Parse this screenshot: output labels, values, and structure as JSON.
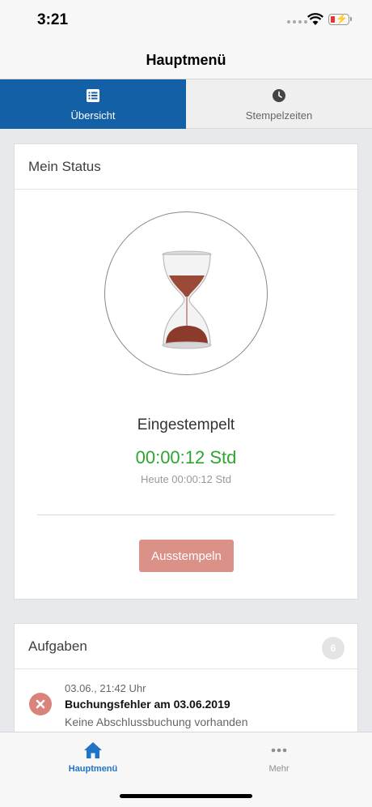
{
  "status_bar": {
    "time": "3:21"
  },
  "nav": {
    "title": "Hauptmenü"
  },
  "tabs": [
    {
      "label": "Übersicht",
      "icon": "list-icon",
      "active": true
    },
    {
      "label": "Stempelzeiten",
      "icon": "clock-icon",
      "active": false
    }
  ],
  "status_card": {
    "title": "Mein Status",
    "state": "Eingestempelt",
    "timer": "00:00:12 Std",
    "today": "Heute 00:00:12 Std",
    "button_label": "Ausstempeln"
  },
  "tasks_card": {
    "title": "Aufgaben",
    "count": "6",
    "items": [
      {
        "date": "03.06., 21:42 Uhr",
        "title": "Buchungsfehler am 03.06.2019",
        "description": "Keine Abschlussbuchung vorhanden",
        "icon": "error-x-icon"
      }
    ]
  },
  "tab_bar": [
    {
      "label": "Hauptmenü",
      "icon": "home-icon",
      "active": true
    },
    {
      "label": "Mehr",
      "icon": "more-dots-icon",
      "active": false
    }
  ],
  "colors": {
    "primary": "#1460a6",
    "timer_green": "#2fa52f",
    "button_red": "#dc9188",
    "tab_active": "#1f74c8"
  }
}
